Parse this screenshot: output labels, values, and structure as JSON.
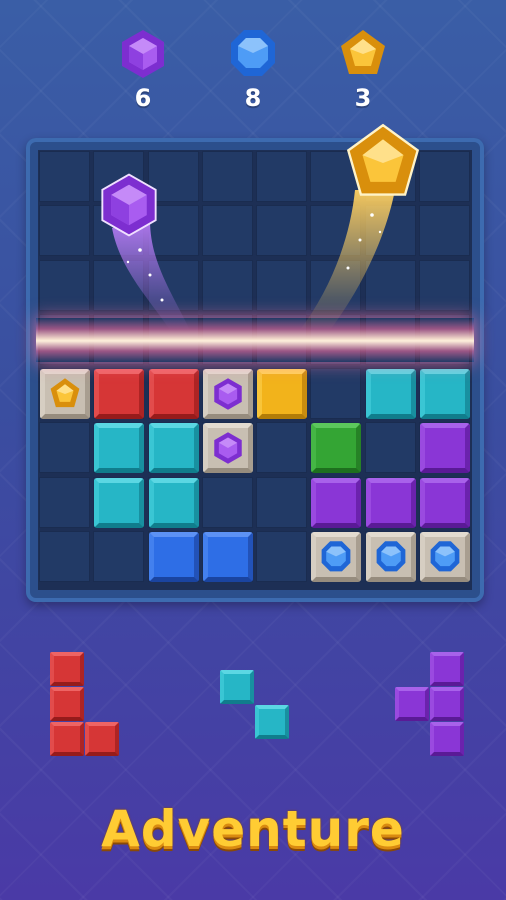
{
  "gem_counters": [
    {
      "gem": "purple-hexagon-gem",
      "count": "6",
      "color": "#9b42e8"
    },
    {
      "gem": "blue-octagon-gem",
      "count": "8",
      "color": "#2f84f0"
    },
    {
      "gem": "yellow-pentagon-gem",
      "count": "3",
      "color": "#f5b41e"
    }
  ],
  "board": {
    "size": 8,
    "clearing_row": 3,
    "rows": [
      [
        "",
        "",
        "",
        "",
        "",
        "",
        "",
        ""
      ],
      [
        "",
        "",
        "",
        "",
        "",
        "",
        "",
        ""
      ],
      [
        "",
        "",
        "",
        "",
        "",
        "",
        "",
        ""
      ],
      [
        "",
        "",
        "",
        "",
        "",
        "",
        "",
        ""
      ],
      [
        "stone-yellow-gem",
        "red",
        "red",
        "stone-purple-gem",
        "yellow",
        "",
        "teal",
        "teal"
      ],
      [
        "",
        "teal",
        "teal",
        "stone-purple-gem",
        "",
        "green",
        "",
        "purple"
      ],
      [
        "",
        "teal",
        "teal",
        "",
        "",
        "purple",
        "purple",
        "purple"
      ],
      [
        "",
        "",
        "blue",
        "blue",
        "",
        "stone-blue-gem",
        "stone-blue-gem",
        "stone-blue-gem"
      ]
    ]
  },
  "flying_gems": [
    "purple-hexagon-gem",
    "yellow-pentagon-gem"
  ],
  "pieces": [
    {
      "color": "red",
      "shape": "L"
    },
    {
      "color": "teal",
      "shape": "diagonal"
    },
    {
      "color": "purple",
      "shape": "T-left"
    }
  ],
  "colors": {
    "red": "#d63636",
    "teal": "#26b6c6",
    "yellow": "#f2b31b",
    "green": "#34a534",
    "purple": "#8a36d6",
    "blue": "#2e6ee6",
    "title": "#ffcc33"
  },
  "title": "Adventure"
}
